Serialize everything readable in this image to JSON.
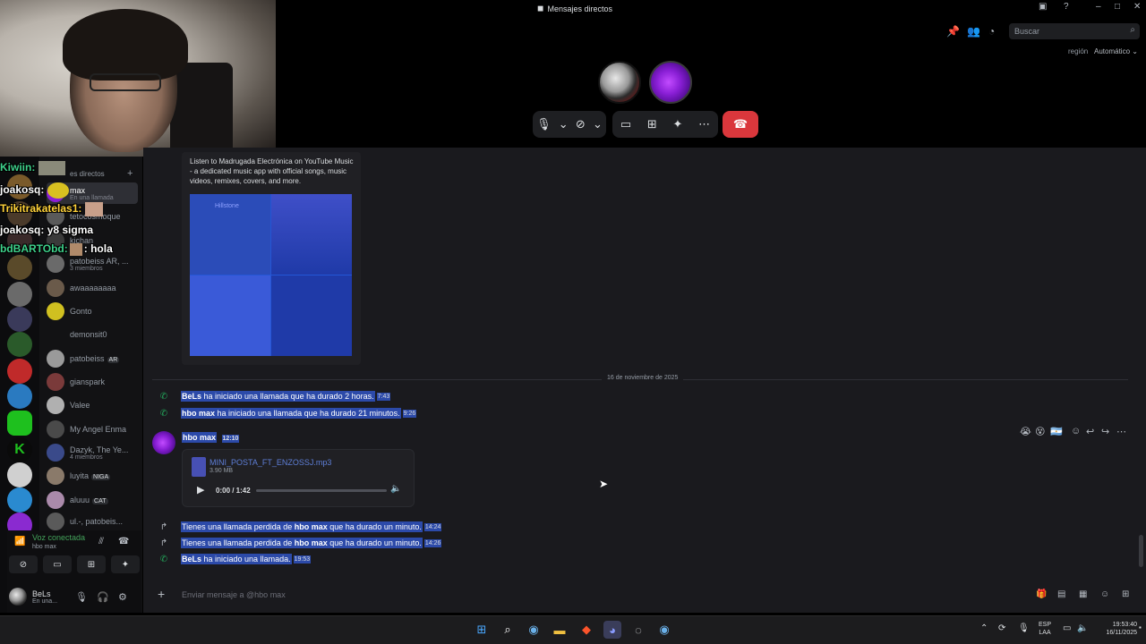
{
  "window": {
    "title": "Mensajes directos",
    "search_placeholder": "Buscar",
    "region_label": "región",
    "region_value": "Automático ⌄"
  },
  "webcam_chat": [
    {
      "user": "Kiwiin:",
      "text": "",
      "color": "#3ed18b"
    },
    {
      "user": "joakosq:",
      "text": "",
      "color": "#ffffff"
    },
    {
      "user": "Trikitrakatelas1:",
      "text": "",
      "color": "#ffd23a"
    },
    {
      "user": "joakosq:",
      "text": "y8 sigma",
      "color": "#ffffff"
    },
    {
      "user": "bdBARTObd:",
      "text": ": hola",
      "color": "#3ed18b"
    }
  ],
  "dm_list": {
    "header": "es directos",
    "items": [
      {
        "name": "max",
        "sub": "En una llamada",
        "badge": ""
      },
      {
        "name": "tetocosmoque",
        "sub": "",
        "badge": ""
      },
      {
        "name": "kichan",
        "sub": "",
        "badge": ""
      },
      {
        "name": "patobeiss AR, ...",
        "sub": "3 miembros",
        "badge": ""
      },
      {
        "name": "awaaaaaaaa",
        "sub": "",
        "badge": ""
      },
      {
        "name": "Gonto",
        "sub": "",
        "badge": ""
      },
      {
        "name": "demonsit0",
        "sub": "",
        "badge": ""
      },
      {
        "name": "patobeiss",
        "sub": "",
        "badge": "AR"
      },
      {
        "name": "gianspark",
        "sub": "",
        "badge": ""
      },
      {
        "name": "Valee",
        "sub": "",
        "badge": ""
      },
      {
        "name": "My Angel Enma",
        "sub": "",
        "badge": ""
      },
      {
        "name": "Dazyk, The Ye...",
        "sub": "4 miembros",
        "badge": ""
      },
      {
        "name": "luyita",
        "sub": "",
        "badge": "NIGA"
      },
      {
        "name": "aluuu",
        "sub": "",
        "badge": "CAT"
      },
      {
        "name": "ul.-, patobeis...",
        "sub": "",
        "badge": ""
      }
    ]
  },
  "voice": {
    "status": "Voz conectada",
    "channel": "hbo max"
  },
  "user": {
    "name": "BeLs",
    "status": "En una..."
  },
  "embed": {
    "text": "Listen to Madrugada Electrónica on YouTube Music - a dedicated music app with official songs, music videos, remixes, covers, and more.",
    "image_caption": "Hillstone"
  },
  "date_divider": "16 de noviembre de 2025",
  "system_messages_top": [
    {
      "icon": "phone-icon",
      "who": "BeLs",
      "text": " ha iniciado una llamada que ha durado 2 horas.",
      "time": "7:43"
    },
    {
      "icon": "phone-icon",
      "who": "hbo max",
      "text": " ha iniciado una llamada que ha durado 21 minutos.",
      "time": "9:26"
    }
  ],
  "message": {
    "author": "hbo max",
    "time": "12:10",
    "file_name": "MINI_POSTA_FT_ENZOSSJ.mp3",
    "file_size": "3.90 MB",
    "audio_time": "0:00 / 1:42",
    "audio_progress": 0
  },
  "system_messages_bottom": [
    {
      "icon": "missed-call-icon",
      "pre": "Tienes una llamada perdida de ",
      "who": "hbo max",
      "text": " que ha durado un minuto.",
      "time": "14:24"
    },
    {
      "icon": "missed-call-icon",
      "pre": "Tienes una llamada perdida de ",
      "who": "hbo max",
      "text": " que ha durado un minuto.",
      "time": "14:26"
    },
    {
      "icon": "phone-icon",
      "pre": "",
      "who": "BeLs",
      "text": " ha iniciado una llamada.",
      "time": "19:53"
    }
  ],
  "composer": {
    "placeholder": "Enviar mensaje a @hbo max"
  },
  "taskbar": {
    "lang_top": "ESP",
    "lang_bottom": "LAA",
    "time": "19:53:40",
    "date": "16/11/2025"
  },
  "colors": {
    "accent": "#5865f2",
    "end_call": "#da373c",
    "online": "#23a55a",
    "selection": "#2c4aa9"
  }
}
